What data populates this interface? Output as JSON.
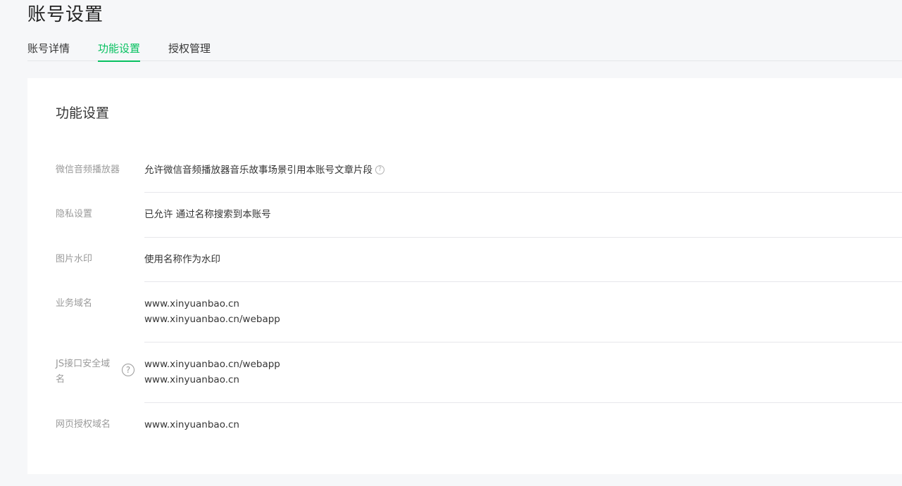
{
  "page_title": "账号设置",
  "tabs": [
    {
      "label": "账号详情",
      "active": false
    },
    {
      "label": "功能设置",
      "active": true
    },
    {
      "label": "授权管理",
      "active": false
    }
  ],
  "section_title": "功能设置",
  "rows": [
    {
      "label": "微信音频播放器",
      "values": [
        "允许微信音频播放器音乐故事场景引用本账号文章片段"
      ],
      "help_icon": "question-circle-icon"
    },
    {
      "label": "隐私设置",
      "values": [
        "已允许 通过名称搜索到本账号"
      ]
    },
    {
      "label": "图片水印",
      "values": [
        "使用名称作为水印"
      ]
    },
    {
      "label": "业务域名",
      "values": [
        "www.xinyuanbao.cn",
        "www.xinyuanbao.cn/webapp"
      ]
    },
    {
      "label_lines": [
        "JS接口安全域",
        "名"
      ],
      "values": [
        "www.xinyuanbao.cn/webapp",
        "www.xinyuanbao.cn"
      ],
      "help_icon": "question-circle-icon"
    },
    {
      "label": "网页授权域名",
      "values": [
        "www.xinyuanbao.cn"
      ]
    }
  ],
  "help_glyph": "?",
  "colors": {
    "accent": "#07c160",
    "label": "#9a9a9a",
    "text": "#353535",
    "background": "#f6f7f9"
  }
}
